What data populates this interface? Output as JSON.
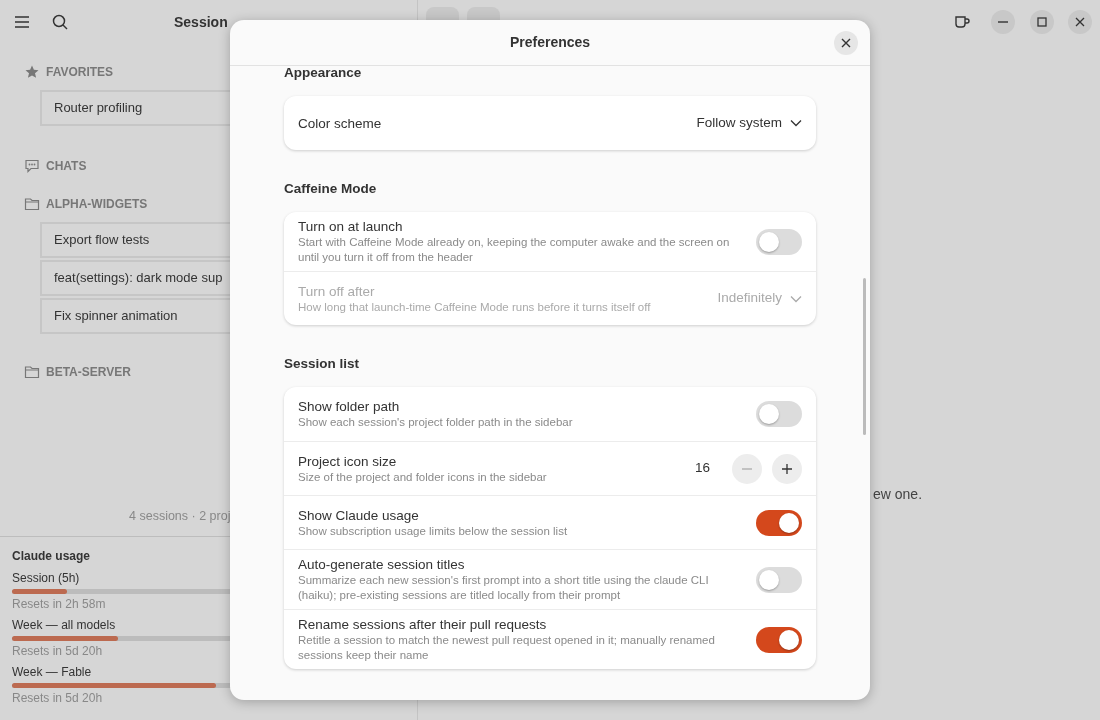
{
  "sidebar": {
    "title": "Session",
    "sections": [
      {
        "kind": "favorites",
        "label": "FAVORITES",
        "items": [
          {
            "title": "Router profiling"
          }
        ]
      },
      {
        "kind": "chats",
        "label": "CHATS"
      },
      {
        "kind": "folder",
        "label": "ALPHA-WIDGETS",
        "items": [
          {
            "title": "Export flow tests"
          },
          {
            "title": "feat(settings): dark mode sup"
          },
          {
            "title": "Fix spinner animation"
          }
        ]
      },
      {
        "kind": "folder",
        "label": "BETA-SERVER"
      }
    ],
    "footer": "4 sessions · 2 proj",
    "usage": {
      "title": "Claude usage",
      "meters": [
        {
          "label": "Session (5h)",
          "level": 0.14,
          "reading": "Resets in 2h 58m"
        },
        {
          "label": "Week — all models",
          "level": 0.27,
          "reading": "Resets in 5d 20h"
        },
        {
          "label": "Week — Fable",
          "level": 0.52,
          "reading": "Resets in 5d 20h"
        }
      ]
    }
  },
  "main": {
    "message": "ew one."
  },
  "dialog": {
    "title": "Preferences",
    "groups": [
      {
        "title": "Appearance",
        "rows": [
          {
            "kind": "dropdown",
            "title": "Color scheme",
            "value": "Follow system"
          }
        ]
      },
      {
        "title": "Caffeine Mode",
        "rows": [
          {
            "kind": "switch",
            "title": "Turn on at launch",
            "subtitle": "Start with Caffeine Mode already on, keeping the computer awake and the screen on until you turn it off from the header",
            "on": false
          },
          {
            "kind": "dropdown",
            "title": "Turn off after",
            "subtitle": "How long that launch-time Caffeine Mode runs before it turns itself off",
            "value": "Indefinitely",
            "disabled": true
          }
        ]
      },
      {
        "title": "Session list",
        "rows": [
          {
            "kind": "switch",
            "title": "Show folder path",
            "subtitle": "Show each session's project folder path in the sidebar",
            "on": false
          },
          {
            "kind": "spin",
            "title": "Project icon size",
            "subtitle": "Size of the project and folder icons in the sidebar",
            "value": "16"
          },
          {
            "kind": "switch",
            "title": "Show Claude usage",
            "subtitle": "Show subscription usage limits below the session list",
            "on": true
          },
          {
            "kind": "switch",
            "title": "Auto-generate session titles",
            "subtitle": "Summarize each new session's first prompt into a short title using the claude CLI (haiku); pre-existing sessions are titled locally from their prompt",
            "on": false
          },
          {
            "kind": "switch",
            "title": "Rename sessions after their pull requests",
            "subtitle": "Retitle a session to match the newest pull request opened in it; manually renamed sessions keep their name",
            "on": true
          }
        ]
      }
    ]
  }
}
